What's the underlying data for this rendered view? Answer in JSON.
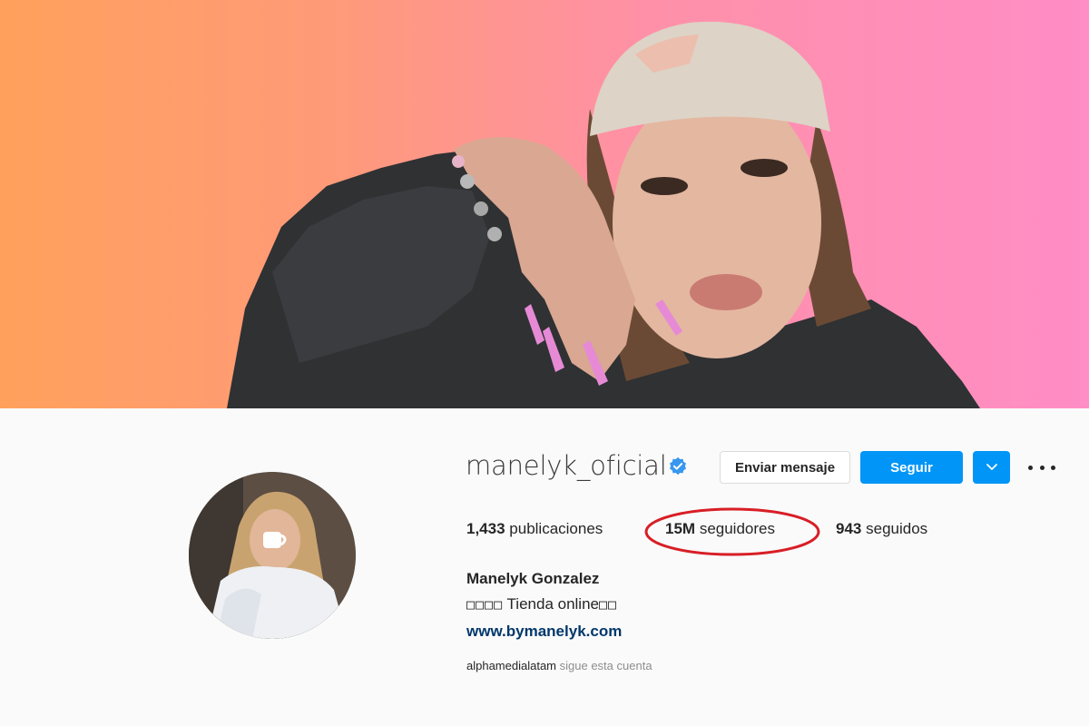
{
  "profile": {
    "username": "manelyk_oficial",
    "verified": true,
    "buttons": {
      "message": "Enviar mensaje",
      "follow": "Seguir",
      "dropdown_icon": "chevron-down-icon",
      "more_icon": "more-horizontal-icon"
    },
    "stats": {
      "posts_count": "1,433",
      "posts_label": "publicaciones",
      "followers_count": "15M",
      "followers_label": "seguidores",
      "following_count": "943",
      "following_label": "seguidos"
    },
    "full_name": "Manelyk Gonzalez",
    "bio_prefix": "□□□□",
    "bio_text": "Tienda online",
    "bio_suffix": "□□",
    "website": "www.bymanelyk.com",
    "followed_by": {
      "account": "alphamedialatam",
      "text": "sigue esta cuenta"
    }
  },
  "colors": {
    "accent_blue": "#0095f6",
    "link_blue": "#00376b",
    "annotation_red": "#d81e26",
    "banner_left": "#ffa15c",
    "banner_right": "#ff8dc6"
  }
}
